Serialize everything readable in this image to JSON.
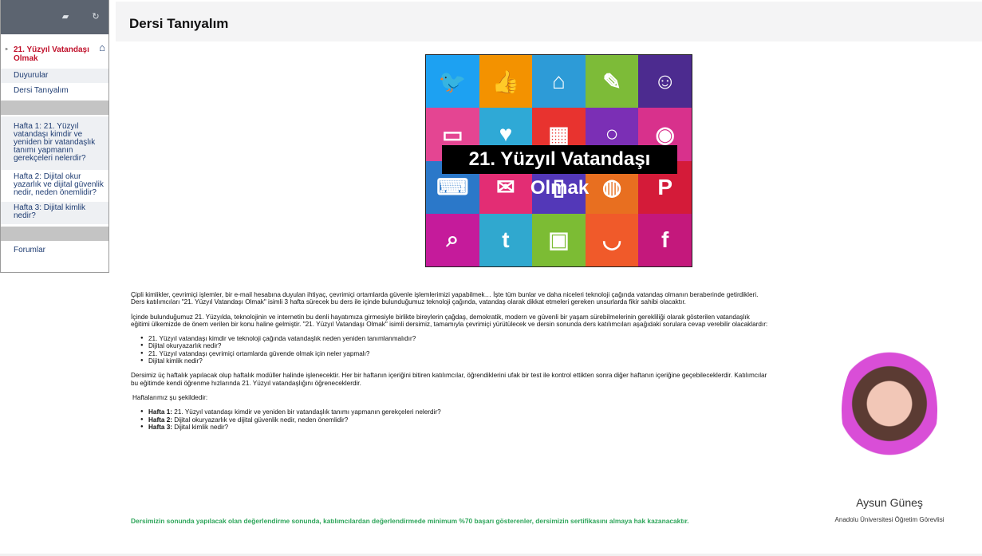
{
  "sidebar": {
    "toolbar_icons": [
      "image-icon",
      "refresh-icon"
    ],
    "course_title": "21. Yüzyıl Vatandaşı Olmak",
    "items": [
      {
        "label": "Duyurular"
      },
      {
        "label": "Dersi Tanıyalım"
      },
      {
        "label": "Hafta 1: 21. Yüzyıl vatandaşı kimdir ve yeniden bir vatandaşlık tanımı yapmanın gerekçeleri nelerdir?"
      },
      {
        "label": "Hafta 2: Dijital okur yazarlık ve dijital güvenlik nedir, neden önemlidir?"
      },
      {
        "label": "Hafta 3: Dijital kimlik nedir?"
      },
      {
        "label": "Forumlar"
      }
    ]
  },
  "page": {
    "title": "Dersi Tanıyalım"
  },
  "banner": {
    "title": "21. Yüzyıl Vatandaşı Olmak"
  },
  "content": {
    "p1": "Çipli kimlikler, çevrimiçi işlemler, bir e-mail hesabına duyulan ihtiyaç, çevrimiçi ortamlarda güvenle işlemlerimizi yapabilmek… İşte tüm bunlar ve daha niceleri teknoloji çağında vatandaş olmanın beraberinde getirdikleri. Ders katılımcıları \"21. Yüzyıl Vatandaşı Olmak\" isimli 3 hafta sürecek bu ders ile içinde bulunduğumuz teknoloji çağında, vatandaş olarak dikkat etmeleri gereken unsurlarda fikir sahibi olacaktır.",
    "p2": "İçinde bulunduğumuz 21. Yüzyılda, teknolojinin ve internetin bu denli hayatımıza girmesiyle birlikte bireylerin çağdaş, demokratik, modern ve güvenli bir yaşam sürebilmelerinin gerekliliği olarak gösterilen vatandaşlık eğitimi ülkemizde de önem verilen bir konu haline gelmiştir. \"21. Yüzyıl Vatandaşı Olmak\" isimli dersimiz, tamamıyla çevrimiçi yürütülecek ve dersin sonunda ders katılımcıları aşağıdaki sorulara cevap verebilir olacaklardır:",
    "questions": [
      "21. Yüzyıl vatandaşı kimdir ve teknoloji çağında vatandaşlık neden yeniden tanımlanmalıdır?",
      "Dijital okuryazarlık nedir?",
      "21. Yüzyıl vatandaşı çevrimiçi ortamlarda güvende olmak için neler yapmalı?",
      "Dijital kimlik nedir?"
    ],
    "p3": "Dersimiz üç haftalık yapılacak olup haftalık modüller halinde işlenecektir. Her bir haftanın içeriğini bitiren katılımcılar, öğrendiklerini ufak bir test ile kontrol ettikten sonra diğer haftanın içeriğine geçebileceklerdir. Katılımcılar bu eğitimde kendi öğrenme hızlarında 21. Yüzyıl vatandaşlığını öğreneceklerdir.",
    "weeks_intro": "Haftalarımız şu şekildedir:",
    "weeks": [
      {
        "label": "Hafta 1:",
        "text": " 21. Yüzyıl vatandaşı kimdir ve yeniden bir vatandaşlık tanımı yapmanın gerekçeleri nelerdir?"
      },
      {
        "label": "Hafta 2:",
        "text": " Dijital okuryazarlık ve dijital güvenlik nedir, neden önemlidir?"
      },
      {
        "label": "Hafta 3:",
        "text": " Dijital kimlik nedir?"
      }
    ],
    "final_note": "Dersimizin sonunda yapılacak olan değerlendirme sonunda, katılımcılardan değerlendirmede minimum %70 başarı gösterenler, dersimizin sertifikasını almaya hak kazanacaktır."
  },
  "instructor": {
    "name": "Aysun Güneş",
    "role": "Anadolu Üniversitesi Öğretim Görevlisi"
  }
}
